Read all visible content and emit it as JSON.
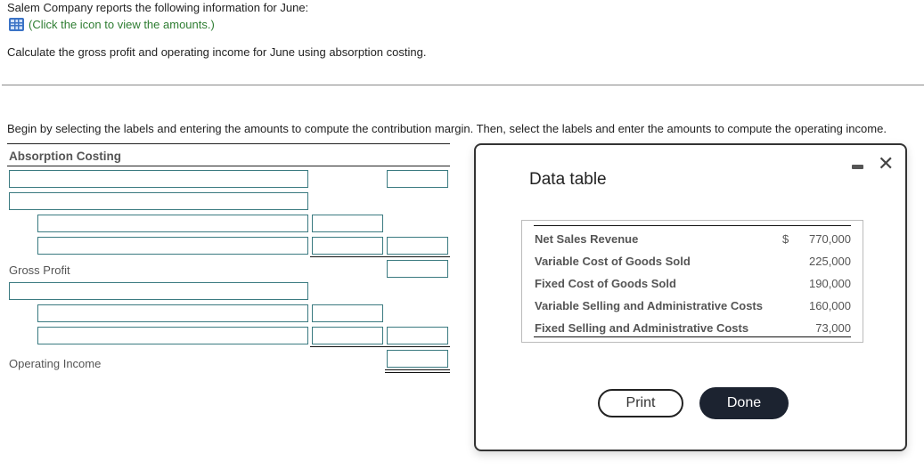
{
  "question": {
    "intro": "Salem Company reports the following information for June:",
    "icon_link": {
      "icon": "data-table-icon",
      "text": "(Click the icon to view the amounts.)"
    },
    "prompt": "Calculate the gross profit and operating income for June using absorption costing.",
    "instruction": "Begin by selecting the labels and entering the amounts to compute the contribution margin. Then, select the labels and enter the amounts to compute the operating income."
  },
  "worksheet": {
    "title": "Absorption Costing",
    "gross_profit_label": "Gross Profit",
    "operating_income_label": "Operating Income",
    "inputs": [
      {
        "label_value": "",
        "col1_value": "",
        "col2_value": ""
      },
      {
        "label_value": "",
        "col1_value": "",
        "col2_value": ""
      },
      {
        "label_value": "",
        "col1_value": "",
        "col2_value": ""
      },
      {
        "label_value": "",
        "col1_value": "",
        "col2_value": ""
      },
      {
        "label_value": "",
        "col1_value": "",
        "col2_value": ""
      },
      {
        "label_value": "",
        "col1_value": "",
        "col2_value": ""
      },
      {
        "label_value": "",
        "col1_value": "",
        "col2_value": ""
      }
    ]
  },
  "dialog": {
    "title": "Data table",
    "minimize_icon": "minimize-icon",
    "close_icon": "close-icon",
    "close_glyph": "✕",
    "rows": [
      {
        "name": "Net Sales Revenue",
        "currency": "$",
        "value": "770,000"
      },
      {
        "name": "Variable Cost of Goods Sold",
        "currency": "",
        "value": "225,000"
      },
      {
        "name": "Fixed Cost of Goods Sold",
        "currency": "",
        "value": "190,000"
      },
      {
        "name": "Variable Selling and Administrative Costs",
        "currency": "",
        "value": "160,000"
      },
      {
        "name": "Fixed Selling and Administrative Costs",
        "currency": "",
        "value": "73,000"
      }
    ],
    "print_label": "Print",
    "done_label": "Done"
  },
  "colors": {
    "link_green": "#2e7d32",
    "input_border": "#3a7a80",
    "done_button_bg": "#1c2330",
    "icon_blue": "#3b73c6"
  }
}
